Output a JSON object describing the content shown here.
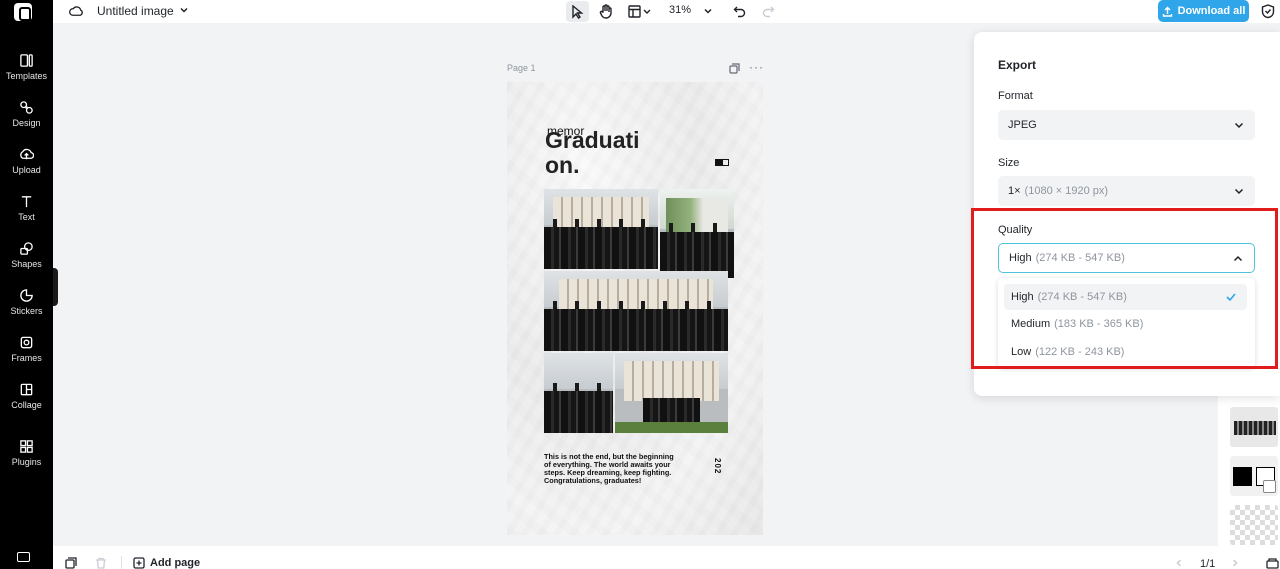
{
  "app": {
    "doc_title": "Untitled image",
    "zoom": "31%",
    "download_label": "Download all"
  },
  "rail": {
    "items": [
      {
        "label": "Templates",
        "icon": "templates-icon"
      },
      {
        "label": "Design",
        "icon": "design-icon"
      },
      {
        "label": "Upload",
        "icon": "upload-icon"
      },
      {
        "label": "Text",
        "icon": "text-icon"
      },
      {
        "label": "Shapes",
        "icon": "shapes-icon"
      },
      {
        "label": "Stickers",
        "icon": "stickers-icon"
      },
      {
        "label": "Frames",
        "icon": "frames-icon"
      },
      {
        "label": "Collage",
        "icon": "collage-icon"
      },
      {
        "label": "Plugins",
        "icon": "plugins-icon"
      }
    ]
  },
  "canvas": {
    "page_label": "Page 1",
    "more": "···",
    "design": {
      "small_word": "memor",
      "title": "Graduati on.",
      "body": "This is not the end, but the beginning of everything. The world awaits your steps. Keep dreaming, keep fighting. Congratulations, graduates!",
      "year": "202"
    }
  },
  "export": {
    "title": "Export",
    "format_label": "Format",
    "format_value": "JPEG",
    "size_label": "Size",
    "size_value": "1×",
    "size_detail": "(1080 × 1920 px)",
    "quality_label": "Quality",
    "quality_value": "High",
    "quality_detail": "(274 KB - 547 KB)",
    "quality_options": [
      {
        "label": "High",
        "detail": "(274 KB - 547 KB)",
        "selected": true
      },
      {
        "label": "Medium",
        "detail": "(183 KB - 365 KB)",
        "selected": false
      },
      {
        "label": "Low",
        "detail": "(122 KB - 243 KB)",
        "selected": false
      }
    ]
  },
  "bottom": {
    "add_page": "Add page",
    "page_count": "1/1"
  },
  "colors": {
    "accent": "#2fa6ea",
    "focus_border": "#4fc3d8",
    "highlight": "#e01c1c",
    "rail_bg": "#000000"
  }
}
